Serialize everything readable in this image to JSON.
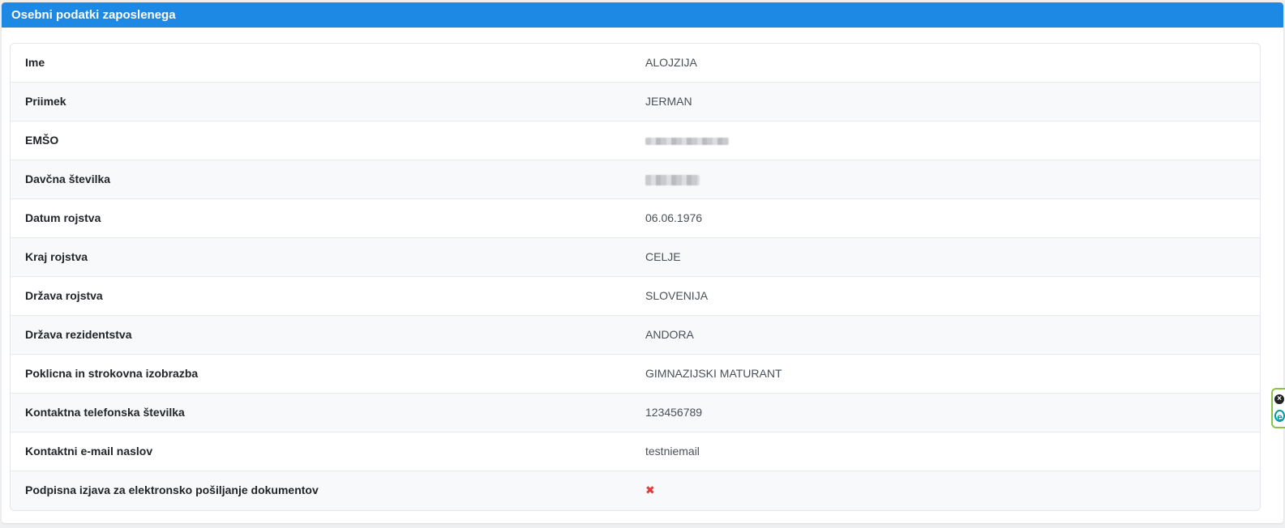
{
  "header": {
    "title": "Osebni podatki zaposlenega"
  },
  "rows": [
    {
      "label": "Ime",
      "value": "ALOJZIJA"
    },
    {
      "label": "Priimek",
      "value": "JERMAN"
    },
    {
      "label": "EMŠO",
      "value": ""
    },
    {
      "label": "Davčna številka",
      "value": ""
    },
    {
      "label": "Datum rojstva",
      "value": "06.06.1976"
    },
    {
      "label": "Kraj rojstva",
      "value": "CELJE"
    },
    {
      "label": "Država rojstva",
      "value": "SLOVENIJA"
    },
    {
      "label": "Država rezidentstva",
      "value": "ANDORA"
    },
    {
      "label": "Poklicna in strokovna izobrazba",
      "value": "GIMNAZIJSKI MATURANT"
    },
    {
      "label": "Kontaktna telefonska številka",
      "value": "123456789"
    },
    {
      "label": "Kontaktni e-mail naslov",
      "value": "testniemail"
    },
    {
      "label": "Podpisna izjava za elektronsko pošiljanje dokumentov",
      "value": "",
      "icon": "x-mark-icon"
    }
  ],
  "widget": {
    "close_glyph": "×",
    "logo_letter": "e"
  },
  "colors": {
    "header": "#1e88e5",
    "x_icon": "#e53935",
    "widget_border": "#8bc34a"
  }
}
